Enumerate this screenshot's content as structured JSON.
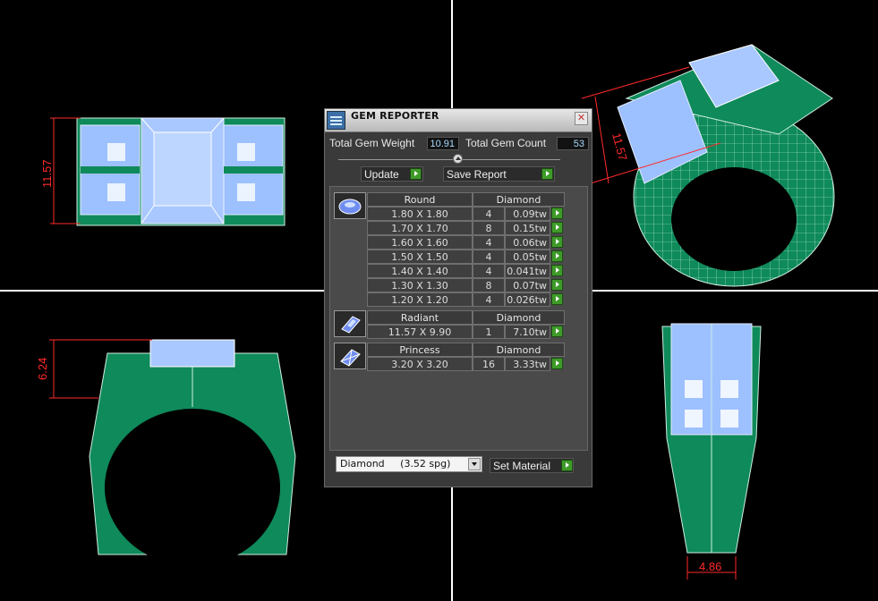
{
  "dimensions": {
    "top_left": "11.57",
    "bottom_left": "6.24",
    "top_right": "11.57",
    "bottom_right": "4.86"
  },
  "colors": {
    "metal": "#0f8a5a",
    "gem": "#a9c8ff",
    "dimension": "#ff2a2a",
    "panel": "#3a3a3a",
    "accent_button": "#3f9a2a"
  },
  "panel": {
    "title": "GEM REPORTER",
    "close_label": "✕",
    "total_weight_label": "Total Gem Weight",
    "total_weight_value": "10.91",
    "total_count_label": "Total Gem Count",
    "total_count_value": "53",
    "update_label": "Update",
    "save_report_label": "Save Report",
    "groups": [
      {
        "shape": "Round",
        "material": "Diamond",
        "rows": [
          {
            "size": "1.80 X 1.80",
            "count": "4",
            "weight": "0.09tw"
          },
          {
            "size": "1.70 X 1.70",
            "count": "8",
            "weight": "0.15tw"
          },
          {
            "size": "1.60 X 1.60",
            "count": "4",
            "weight": "0.06tw"
          },
          {
            "size": "1.50 X 1.50",
            "count": "4",
            "weight": "0.05tw"
          },
          {
            "size": "1.40 X 1.40",
            "count": "4",
            "weight": "0.041tw"
          },
          {
            "size": "1.30 X 1.30",
            "count": "8",
            "weight": "0.07tw"
          },
          {
            "size": "1.20 X 1.20",
            "count": "4",
            "weight": "0.026tw"
          }
        ]
      },
      {
        "shape": "Radiant",
        "material": "Diamond",
        "rows": [
          {
            "size": "11.57 X 9.90",
            "count": "1",
            "weight": "7.10tw"
          }
        ]
      },
      {
        "shape": "Princess",
        "material": "Diamond",
        "rows": [
          {
            "size": "3.20 X 3.20",
            "count": "16",
            "weight": "3.33tw"
          }
        ]
      }
    ],
    "material_select": "Diamond     (3.52 spg)",
    "set_material_label": "Set Material"
  }
}
